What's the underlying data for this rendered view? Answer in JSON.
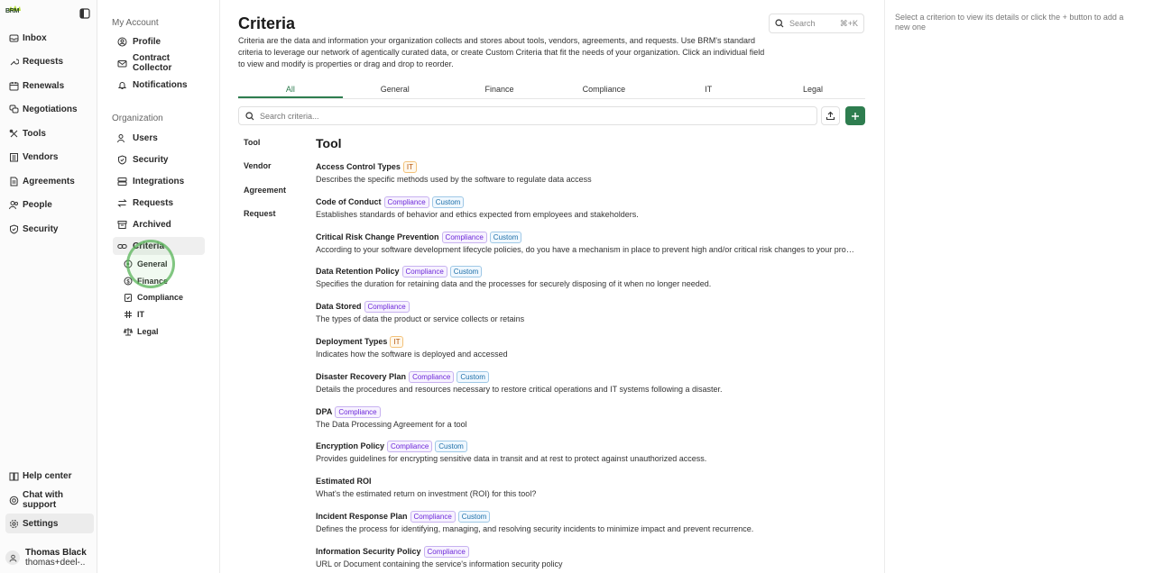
{
  "app": {
    "logo_text": "BRM"
  },
  "nav": {
    "items": [
      {
        "label": "Inbox"
      },
      {
        "label": "Requests"
      },
      {
        "label": "Renewals"
      },
      {
        "label": "Negotiations"
      },
      {
        "label": "Tools"
      },
      {
        "label": "Vendors"
      },
      {
        "label": "Agreements"
      },
      {
        "label": "People"
      },
      {
        "label": "Security"
      }
    ],
    "bottom": [
      {
        "label": "Help center"
      },
      {
        "label": "Chat with support"
      },
      {
        "label": "Settings"
      }
    ],
    "user": {
      "name": "Thomas Black",
      "email": "thomas+deel-..."
    }
  },
  "settings": {
    "my_account_heading": "My Account",
    "my_account": [
      {
        "label": "Profile"
      },
      {
        "label": "Contract Collector"
      },
      {
        "label": "Notifications"
      }
    ],
    "organization_heading": "Organization",
    "organization": [
      {
        "label": "Users"
      },
      {
        "label": "Security"
      },
      {
        "label": "Integrations"
      },
      {
        "label": "Requests"
      },
      {
        "label": "Archived"
      },
      {
        "label": "Criteria"
      }
    ],
    "criteria_sub": [
      {
        "label": "General"
      },
      {
        "label": "Finance"
      },
      {
        "label": "Compliance"
      },
      {
        "label": "IT"
      },
      {
        "label": "Legal"
      }
    ]
  },
  "main": {
    "title": "Criteria",
    "description": "Criteria are the data and information your organization collects and stores about tools, vendors, agreements, and requests. Use BRM's standard criteria to leverage our network of agentically curated data, or create Custom Criteria that fit the needs of your organization. Click an individual field to view and modify is properties or drag and drop to reorder.",
    "search": {
      "placeholder": "Search",
      "shortcut": "⌘+K"
    },
    "tabs": [
      {
        "label": "All"
      },
      {
        "label": "General"
      },
      {
        "label": "Finance"
      },
      {
        "label": "Compliance"
      },
      {
        "label": "IT"
      },
      {
        "label": "Legal"
      }
    ],
    "criteria_search_placeholder": "Search criteria...",
    "categories": [
      {
        "label": "Tool"
      },
      {
        "label": "Vendor"
      },
      {
        "label": "Agreement"
      },
      {
        "label": "Request"
      }
    ],
    "list_title": "Tool",
    "criteria": [
      {
        "name": "Access Control Types",
        "tags": [
          "IT"
        ],
        "description": "Describes the specific methods used by the software to regulate data access"
      },
      {
        "name": "Code of Conduct",
        "tags": [
          "Compliance",
          "Custom"
        ],
        "description": "Establishes standards of behavior and ethics expected from employees and stakeholders."
      },
      {
        "name": "Critical Risk Change Prevention",
        "tags": [
          "Compliance",
          "Custom"
        ],
        "description": "According to your software development lifecycle policies, do you have a mechanism in place to prevent high and/or critical risk changes to your production environment?"
      },
      {
        "name": "Data Retention Policy",
        "tags": [
          "Compliance",
          "Custom"
        ],
        "description": "Specifies the duration for retaining data and the processes for securely disposing of it when no longer needed."
      },
      {
        "name": "Data Stored",
        "tags": [
          "Compliance"
        ],
        "description": "The types of data the product or service collects or retains"
      },
      {
        "name": "Deployment Types",
        "tags": [
          "IT"
        ],
        "description": "Indicates how the software is deployed and accessed"
      },
      {
        "name": "Disaster Recovery Plan",
        "tags": [
          "Compliance",
          "Custom"
        ],
        "description": "Details the procedures and resources necessary to restore critical operations and IT systems following a disaster."
      },
      {
        "name": "DPA",
        "tags": [
          "Compliance"
        ],
        "description": "The Data Processing Agreement for a tool"
      },
      {
        "name": "Encryption Policy",
        "tags": [
          "Compliance",
          "Custom"
        ],
        "description": "Provides guidelines for encrypting sensitive data in transit and at rest to protect against unauthorized access."
      },
      {
        "name": "Estimated ROI",
        "tags": [],
        "description": "What's the estimated return on investment (ROI) for this tool?"
      },
      {
        "name": "Incident Response Plan",
        "tags": [
          "Compliance",
          "Custom"
        ],
        "description": "Defines the process for identifying, managing, and resolving security incidents to minimize impact and prevent recurrence."
      },
      {
        "name": "Information Security Policy",
        "tags": [
          "Compliance"
        ],
        "description": "URL or Document containing the service's information security policy"
      }
    ]
  },
  "right_panel": {
    "hint": "Select a criterion to view its details or click the + button to add a new one"
  },
  "colors": {
    "accent": "#2e7d4f"
  }
}
